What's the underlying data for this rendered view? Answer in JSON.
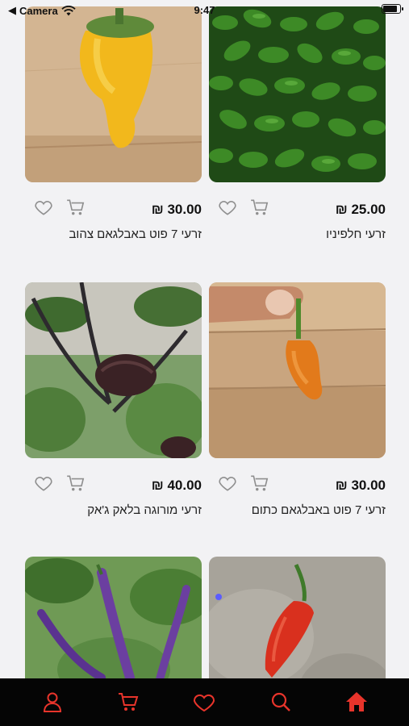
{
  "status": {
    "carrier": "Camera",
    "time": "9:47",
    "battery_level": 0.85
  },
  "products": [
    {
      "name": "זרעי 7 פוט באבלגאם צהוב",
      "price": "₪ 30.00",
      "image": "yellow-7pot-pepper"
    },
    {
      "name": "זרעי חלפיניו",
      "price": "₪ 25.00",
      "image": "jalapeno-pile"
    },
    {
      "name": "זרעי מורוגה בלאק ג'אק",
      "price": "₪ 40.00",
      "image": "black-pepper-plant"
    },
    {
      "name": "זרעי 7 פוט באבלגאם כתום",
      "price": "₪ 30.00",
      "image": "orange-7pot-pepper"
    },
    {
      "name": "",
      "price": "",
      "image": "purple-pepper-plant"
    },
    {
      "name": "",
      "price": "",
      "image": "red-pepper-on-stone"
    }
  ],
  "tabbar": {
    "accent": "#e8342b",
    "items": [
      {
        "icon": "user-icon"
      },
      {
        "icon": "cart-icon"
      },
      {
        "icon": "heart-icon"
      },
      {
        "icon": "search-icon"
      },
      {
        "icon": "home-icon"
      }
    ]
  }
}
